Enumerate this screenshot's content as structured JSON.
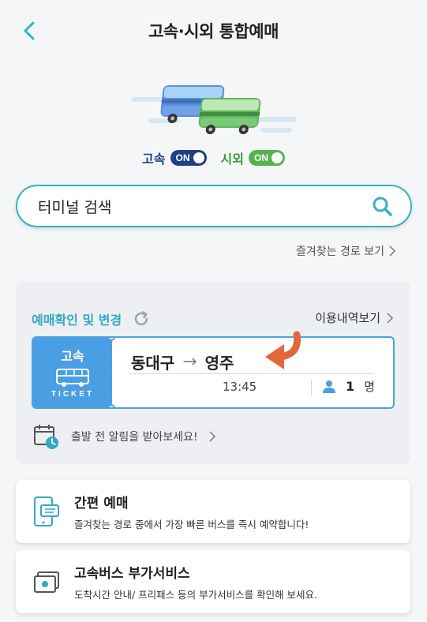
{
  "header": {
    "title": "고속·시외 통합예매",
    "back_icon": "chevron-left-icon"
  },
  "toggles": {
    "express": {
      "label": "고속",
      "state": "ON"
    },
    "intercity": {
      "label": "시외",
      "state": "ON"
    }
  },
  "search": {
    "placeholder": "터미널 검색",
    "icon": "search-icon"
  },
  "favorites_link": "즐겨찾는 경로 보기",
  "reservation": {
    "title": "예매확인 및 변경",
    "history_link": "이용내역보기",
    "ticket": {
      "type": "고속",
      "tag": "TICKET",
      "origin": "동대구",
      "destination": "영주",
      "time": "13:45",
      "passengers": "1",
      "passenger_unit": "명"
    },
    "alarm_text": "출발 전 알림을 받아보세요!"
  },
  "services": [
    {
      "title": "간편 예매",
      "desc": "즐겨찾는 경로 중에서 가장 빠른 버스를 즉시 예약합니다!",
      "icon": "mobile-ticket-icon"
    },
    {
      "title": "고속버스 부가서비스",
      "desc": "도착시간 안내/ 프리패스 등의 부가서비스를 확인해 보세요.",
      "icon": "ticket-stack-icon"
    }
  ],
  "colors": {
    "accent": "#33b3c6",
    "express": "#1f3f86",
    "intercity": "#55b34d",
    "ticket_blue": "#4a9fe4",
    "annotation_arrow": "#e2683c"
  }
}
